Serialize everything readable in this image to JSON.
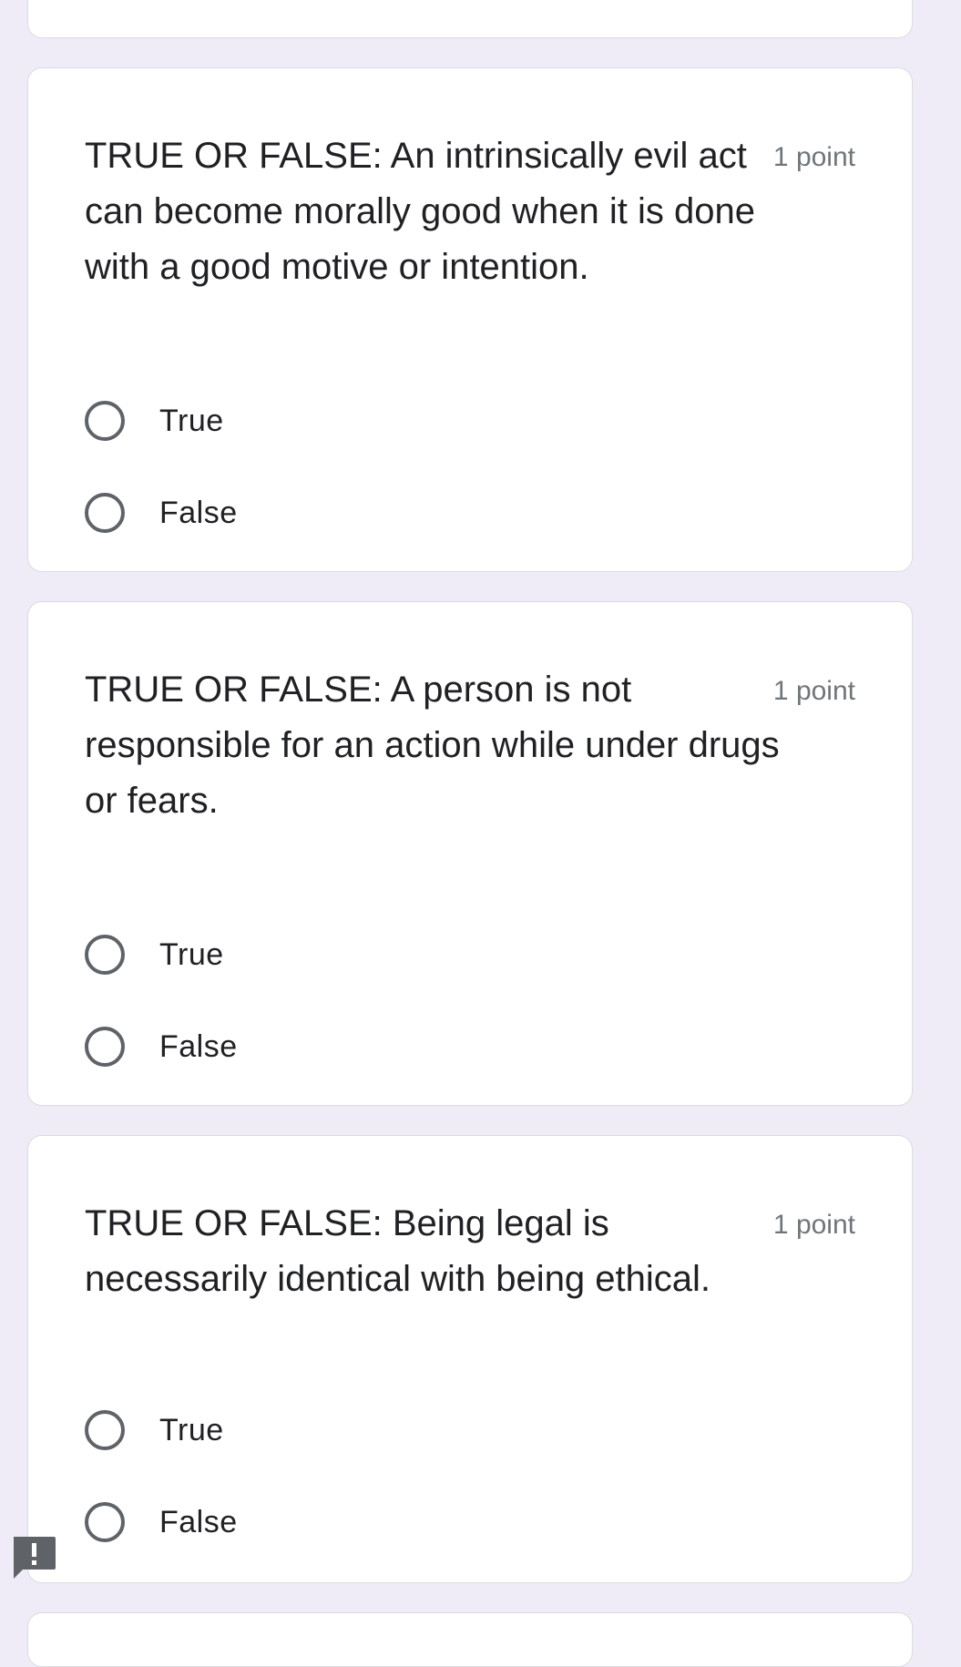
{
  "questions": [
    {
      "title": "TRUE OR FALSE: An intrinsically evil act can become morally good when it is done with a good motive or intention.",
      "points": "1 point",
      "options": [
        "True",
        "False"
      ]
    },
    {
      "title": "TRUE OR FALSE: A person is not responsible for an action while under drugs or fears.",
      "points": "1 point",
      "options": [
        "True",
        "False"
      ]
    },
    {
      "title": "TRUE OR FALSE: Being legal is necessarily identical with being ethical.",
      "points": "1 point",
      "options": [
        "True",
        "False"
      ]
    }
  ],
  "icons": {
    "radio": "radio-unchecked-icon",
    "feedback": "report-feedback-icon"
  },
  "colors": {
    "background": "#efecf7",
    "card": "#ffffff",
    "card_border": "#dadce0",
    "text": "#202124",
    "secondary_text": "#70757a",
    "radio_border": "#5f6368",
    "feedback_icon": "#5f6368"
  }
}
